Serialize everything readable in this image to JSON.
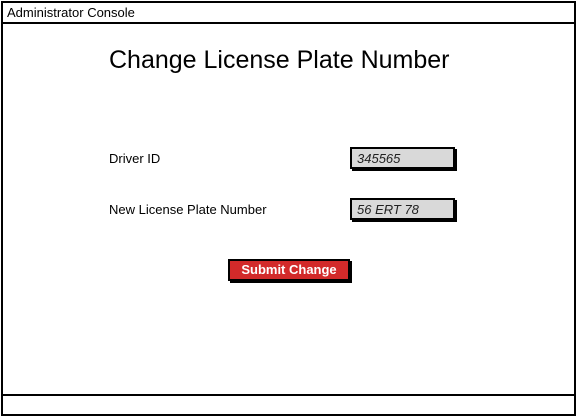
{
  "window": {
    "title": "Administrator Console"
  },
  "form": {
    "heading": "Change License Plate Number",
    "driver_id": {
      "label": "Driver ID",
      "value": "345565"
    },
    "plate_number": {
      "label": "New License Plate Number",
      "value": "56 ERT 78"
    },
    "submit_label": "Submit Change"
  },
  "colors": {
    "submit_button_bg": "#d22a2a",
    "input_bg": "#d9d9d9",
    "border": "#000000"
  }
}
